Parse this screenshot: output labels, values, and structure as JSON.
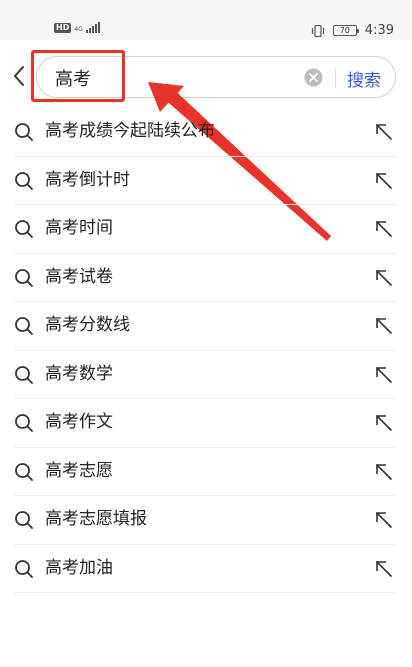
{
  "status_bar": {
    "hd": "HD",
    "network": "4G",
    "battery": "70",
    "time": "4:39"
  },
  "search": {
    "query": "高考",
    "button_label": "搜索"
  },
  "suggestions": [
    {
      "text": "高考成绩今起陆续公布"
    },
    {
      "text": "高考倒计时"
    },
    {
      "text": "高考时间"
    },
    {
      "text": "高考试卷"
    },
    {
      "text": "高考分数线"
    },
    {
      "text": "高考数学"
    },
    {
      "text": "高考作文"
    },
    {
      "text": "高考志愿"
    },
    {
      "text": "高考志愿填报"
    },
    {
      "text": "高考加油"
    }
  ],
  "colors": {
    "accent": "#3a5bd9",
    "annotation": "#e8332a"
  }
}
